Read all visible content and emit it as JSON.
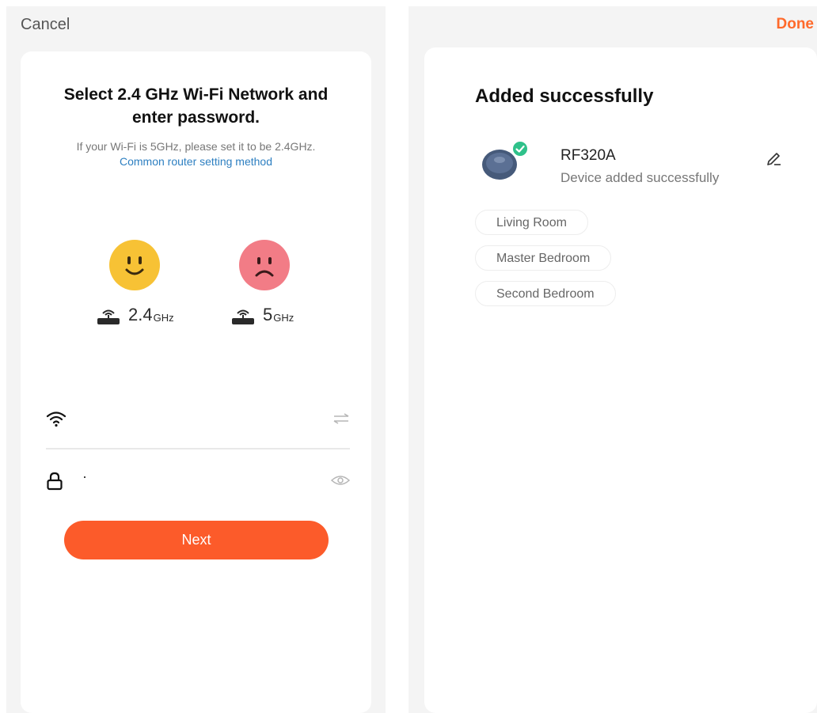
{
  "left_screen": {
    "cancel_label": "Cancel",
    "heading_line1": "Select 2.4 GHz Wi-Fi Network and",
    "heading_line2": "enter password.",
    "hint": "If your Wi-Fi is 5GHz, please set it to be 2.4GHz.",
    "router_link": "Common router setting method",
    "bands": [
      {
        "value": "2.4",
        "unit": "GHz",
        "status": "supported",
        "face_icon": "happy-face-icon",
        "color": "#f7c235"
      },
      {
        "value": "5",
        "unit": "GHz",
        "status": "unsupported",
        "face_icon": "sad-face-icon",
        "color": "#f27c86"
      }
    ],
    "ssid_field": {
      "value": "",
      "lead_icon": "wifi-icon",
      "trail_icon": "switch-network-icon"
    },
    "password_field": {
      "value": "·",
      "lead_icon": "lock-icon",
      "trail_icon": "eye-icon"
    },
    "next_label": "Next",
    "accent_color": "#fc5b2a"
  },
  "right_screen": {
    "done_label": "Done",
    "title": "Added successfully",
    "device": {
      "name": "RF320A",
      "status": "Device added successfully",
      "avatar_icon": "robot-vacuum-icon",
      "badge_icon": "check-icon",
      "edit_icon": "pencil-icon"
    },
    "rooms": [
      "Living Room",
      "Master Bedroom",
      "Second Bedroom"
    ],
    "done_color": "#ff6a2b",
    "success_color": "#2fc18a"
  }
}
